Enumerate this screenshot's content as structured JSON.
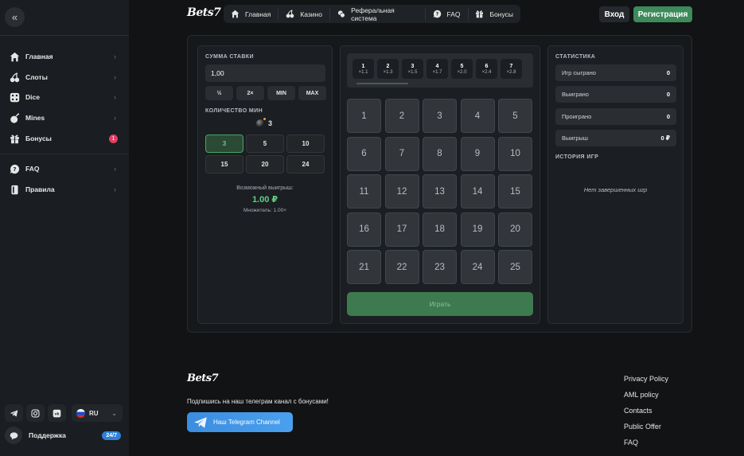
{
  "brand": {
    "logo_text": "Bets7"
  },
  "header": {
    "nav": [
      {
        "label": "Главная",
        "icon": "home-icon"
      },
      {
        "label": "Казино",
        "icon": "cherries-icon"
      },
      {
        "label": "Реферальная система",
        "icon": "coins-icon"
      },
      {
        "label": "FAQ",
        "icon": "question-icon"
      },
      {
        "label": "Бонусы",
        "icon": "gift-icon"
      }
    ],
    "login_label": "Вход",
    "register_label": "Регистрация",
    "register_color": "#3d8a5b"
  },
  "sidebar": {
    "collapse_icon": "double-chevron-left-icon",
    "items": [
      {
        "label": "Главная",
        "icon": "home-icon"
      },
      {
        "label": "Слоты",
        "icon": "cherries-icon"
      },
      {
        "label": "Dice",
        "icon": "dice-icon"
      },
      {
        "label": "Mines",
        "icon": "bomb-icon"
      },
      {
        "label": "Бонусы",
        "icon": "gift-icon",
        "badge": "1"
      },
      {
        "label": "FAQ",
        "icon": "question-icon"
      },
      {
        "label": "Правила",
        "icon": "book-icon"
      }
    ],
    "language": "RU",
    "support_label": "Поддержка",
    "support_badge": "24/7"
  },
  "game": {
    "bet_title": "СУММА СТАВКИ",
    "bet_value": "1,00",
    "quick_buttons": [
      "½",
      "2×",
      "MIN",
      "MAX"
    ],
    "mines_title": "КОЛИЧЕСТВО МИН",
    "mines_selected": "3",
    "mine_options": [
      "3",
      "5",
      "10",
      "15",
      "20",
      "24"
    ],
    "possible_win_label": "Возможный выигрыш:",
    "possible_win_value": "1.00 ₽",
    "multiplier_label": "Множитель: 1.00×",
    "multipliers": [
      {
        "n": "1",
        "x": "×1.1"
      },
      {
        "n": "2",
        "x": "×1.3"
      },
      {
        "n": "3",
        "x": "×1.5"
      },
      {
        "n": "4",
        "x": "×1.7"
      },
      {
        "n": "5",
        "x": "×2.0"
      },
      {
        "n": "6",
        "x": "×2.4"
      },
      {
        "n": "7",
        "x": "×2.8"
      }
    ],
    "tiles": [
      "1",
      "2",
      "3",
      "4",
      "5",
      "6",
      "7",
      "8",
      "9",
      "10",
      "11",
      "12",
      "13",
      "14",
      "15",
      "16",
      "17",
      "18",
      "19",
      "20",
      "21",
      "22",
      "23",
      "24",
      "25"
    ],
    "play_label": "Играть",
    "accent_color": "#5fd083"
  },
  "stats": {
    "title": "СТАТИСТИКА",
    "rows": [
      {
        "label": "Игр сыграно",
        "value": "0"
      },
      {
        "label": "Выиграно",
        "value": "0"
      },
      {
        "label": "Проиграно",
        "value": "0"
      },
      {
        "label": "Выигрыш",
        "value": "0 ₽"
      }
    ],
    "history_title": "ИСТОРИЯ ИГР",
    "no_games": "Нет завершенных игр"
  },
  "footer": {
    "subscribe_text": "Подпишись на наш телеграм канал с бонусами!",
    "telegram_label": "Наш Telegram Channel",
    "links": [
      "Privacy Policy",
      "AML policy",
      "Contacts",
      "Public Offer",
      "FAQ"
    ]
  }
}
